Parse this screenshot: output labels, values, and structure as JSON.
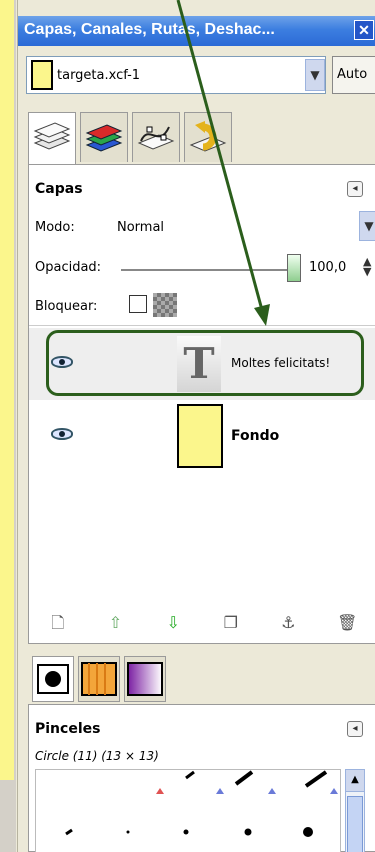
{
  "window": {
    "title": "Capas, Canales, Rutas, Deshac..."
  },
  "image": {
    "name": "targeta.xcf-1",
    "auto_label": "Auto"
  },
  "layers_panel": {
    "title": "Capas",
    "mode_label": "Modo:",
    "mode_value": "Normal",
    "opacity_label": "Opacidad:",
    "opacity_value": "100,0",
    "opacity_percent": 100,
    "lock_label": "Bloquear:",
    "layers": [
      {
        "name": "Moltes felicitats!",
        "visible": true,
        "selected": true,
        "type": "text"
      },
      {
        "name": "Fondo",
        "visible": true,
        "selected": false,
        "type": "image"
      }
    ]
  },
  "brushes_panel": {
    "title": "Pinceles",
    "current": "Circle (11) (13 × 13)"
  },
  "colors": {
    "titlebar": "#3c7ee0",
    "highlight": "#2b5e1c",
    "yellow": "#fbf68c"
  },
  "icons": {
    "tabs": [
      "layers-icon",
      "channels-icon",
      "paths-icon",
      "undo-icon"
    ],
    "toolbar": [
      "new-layer-icon",
      "raise-layer-icon",
      "lower-layer-icon",
      "duplicate-layer-icon",
      "anchor-layer-icon",
      "delete-layer-icon"
    ]
  }
}
